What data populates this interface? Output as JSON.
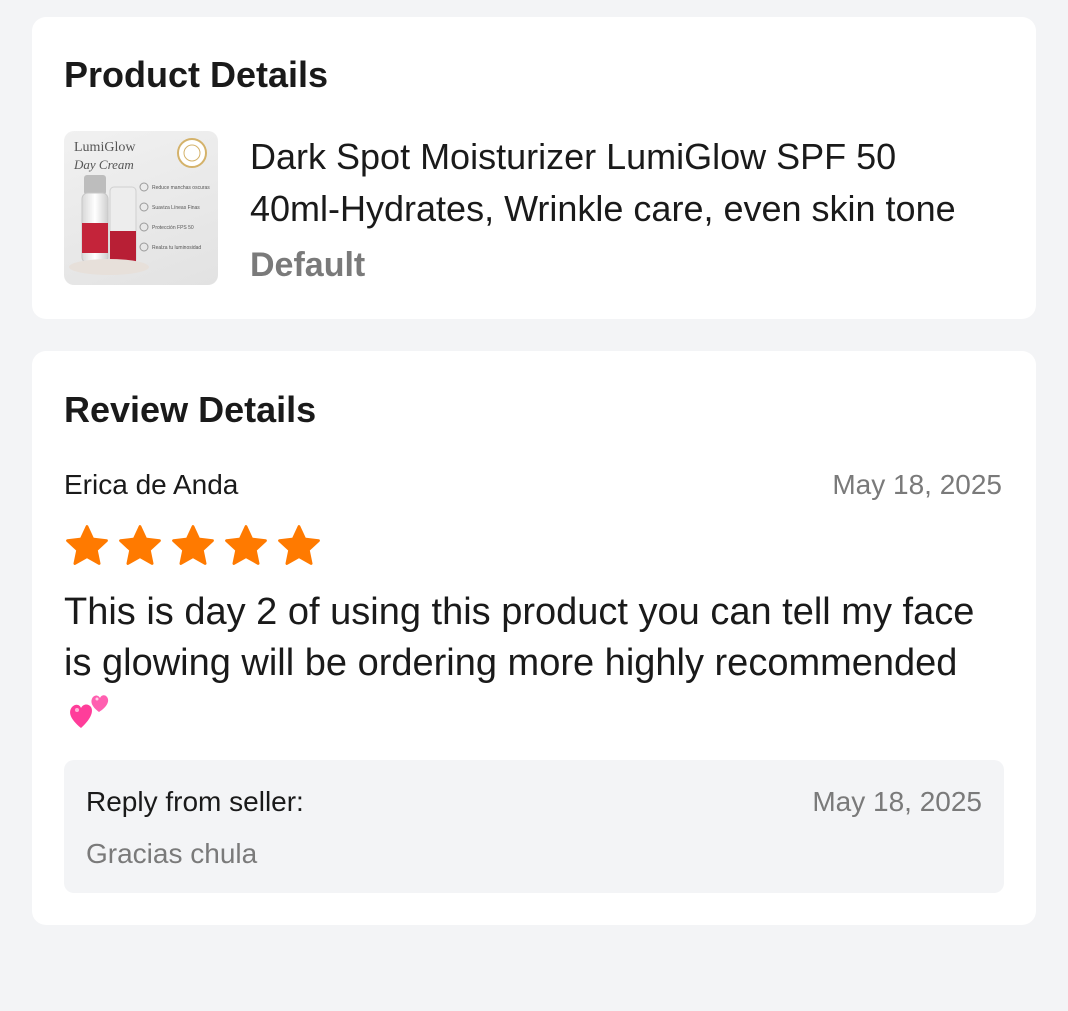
{
  "product_details": {
    "title": "Product Details",
    "product_name": "Dark Spot Moisturizer LumiGlow SPF 50 40ml-Hydrates,  Wrinkle care, even skin tone",
    "variant": "Default",
    "thumbnail": {
      "brand": "LumiGlow",
      "subtitle": "Day Cream",
      "features": [
        "Reduce manchas oscuras",
        "Suaviza Líneas Finas",
        "Protección FPS 50",
        "Realza tu luminosidad"
      ]
    }
  },
  "review_details": {
    "title": "Review Details",
    "reviewer_name": "Erica de Anda",
    "date": "May 18, 2025",
    "rating": 5,
    "rating_max": 5,
    "text": "This is day 2 of using this product you can tell my face is glowing will be ordering more highly recommended",
    "emoji": "two-hearts",
    "seller_reply": {
      "label": "Reply from seller:",
      "date": "May 18, 2025",
      "text": "Gracias chula"
    }
  },
  "colors": {
    "star": "#ff7a00",
    "page_background": "#f3f4f6",
    "card_background": "#ffffff",
    "muted_text": "#7a7a7a",
    "emoji_heart": "#ff3d9a"
  }
}
